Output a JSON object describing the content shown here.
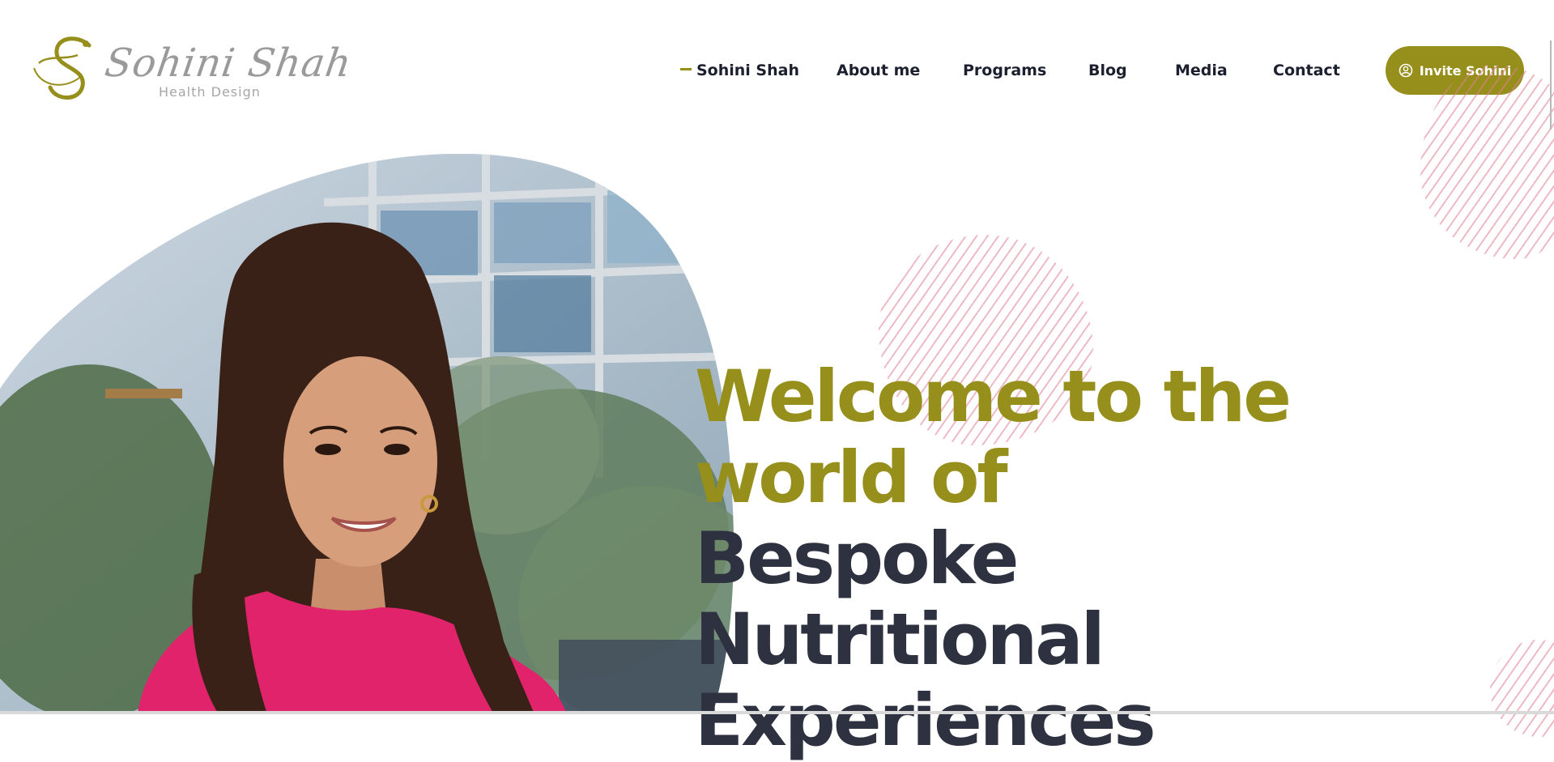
{
  "logo": {
    "name": "Sohini Shah",
    "tagline": "Health Design",
    "monogram": "S"
  },
  "nav": {
    "items": [
      {
        "label": "Sohini Shah",
        "active": true
      },
      {
        "label": "About me",
        "active": false
      },
      {
        "label": "Programs",
        "active": false
      },
      {
        "label": "Blog",
        "active": false
      },
      {
        "label": "Media",
        "active": false
      },
      {
        "label": "Contact",
        "active": false
      }
    ],
    "cta_label": "Invite Sohini",
    "cta_icon": "user-circle-icon"
  },
  "hero": {
    "line1": "Welcome to the",
    "line2": "world of",
    "line3": "Bespoke",
    "line4": "Nutritional",
    "line5": "Experiences"
  },
  "colors": {
    "brand_olive": "#968f1c",
    "heading_dark": "#2e3140",
    "nav_text": "#1c1f2e",
    "stripe_pink": "#e08096",
    "shirt_pink": "#e0236a"
  }
}
